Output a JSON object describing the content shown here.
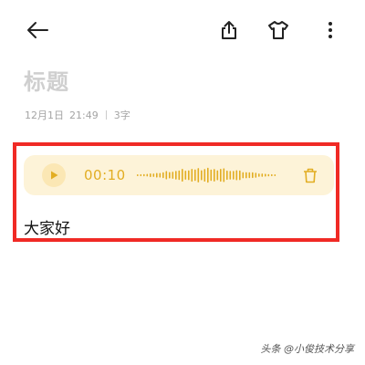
{
  "toolbar": {
    "back_icon": "back-arrow-icon",
    "share_icon": "share-icon",
    "theme_icon": "tshirt-icon",
    "more_icon": "more-vertical-icon"
  },
  "note": {
    "title_placeholder": "标题",
    "date": "12月1日",
    "time": "21:49",
    "char_count": "3字",
    "body_text": "大家好"
  },
  "audio": {
    "duration": "00:10",
    "play_icon": "play-icon",
    "delete_icon": "trash-icon"
  },
  "watermark": "头条 @小俊技术分享",
  "colors": {
    "accent": "#e2ad22",
    "audio_bg": "#fdf3d8",
    "play_bg": "#fbe7b4",
    "highlight_border": "#f02a25",
    "title_placeholder": "#cfcfcf",
    "meta_text": "#a4a4a4"
  }
}
